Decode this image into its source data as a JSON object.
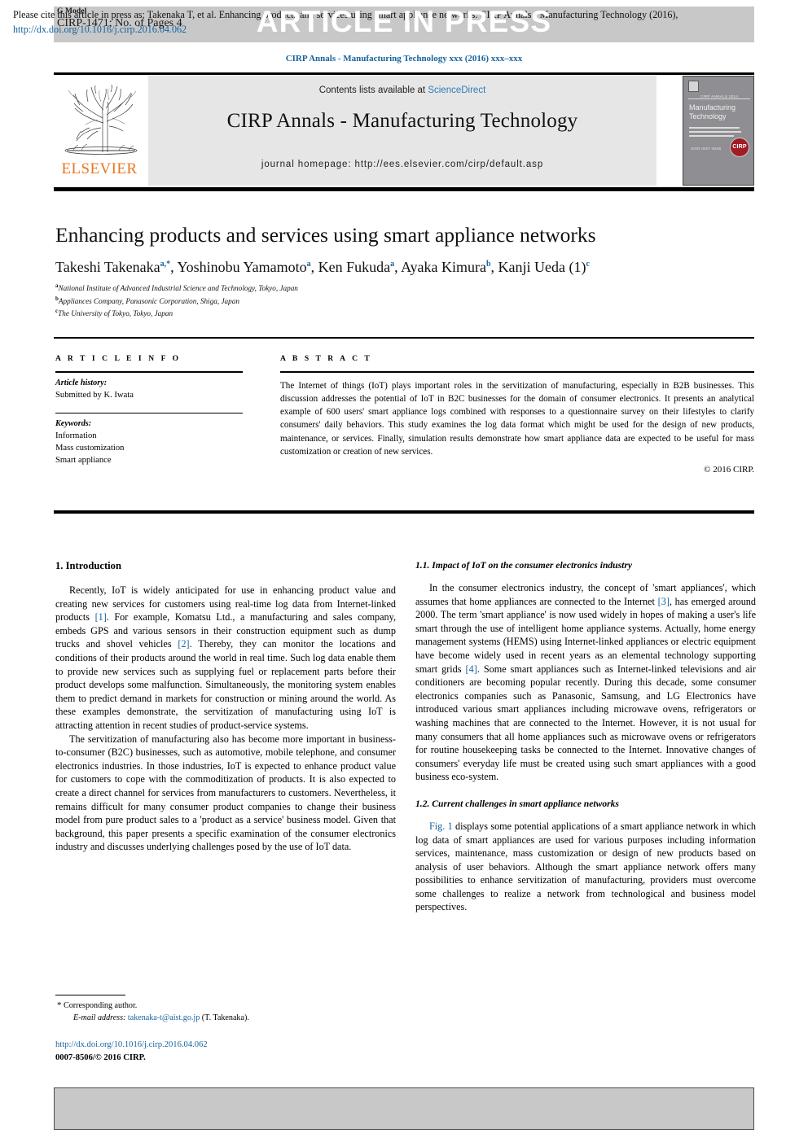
{
  "header": {
    "g_model_label": "G Model",
    "article_id": "CIRP-1471; No. of Pages 4",
    "article_in_press": "ARTICLE IN PRESS",
    "journal_ref": "CIRP Annals - Manufacturing Technology xxx (2016) xxx–xxx"
  },
  "masthead": {
    "contents_prefix": "Contents lists available at ",
    "contents_link": "ScienceDirect",
    "journal_name": "CIRP Annals - Manufacturing Technology",
    "homepage": "journal homepage: http://ees.elsevier.com/cirp/default.asp",
    "publisher_logo_text": "ELSEVIER",
    "cover": {
      "annals_line": "CIRP ANNALS 2014",
      "title_line1": "Manufacturing",
      "title_line2": "Technology",
      "issn_line": "ISSN 0007-8506",
      "seal_text": "CIRP"
    },
    "link_color": "#2e7cb8"
  },
  "article": {
    "title": "Enhancing products and services using smart appliance networks",
    "authors": [
      {
        "name": "Takeshi Takenaka",
        "marks": "a,*"
      },
      {
        "name": "Yoshinobu Yamamoto",
        "marks": "a"
      },
      {
        "name": "Ken Fukuda",
        "marks": "a"
      },
      {
        "name": "Ayaka Kimura",
        "marks": "b"
      },
      {
        "name": "Kanji Ueda (1)",
        "marks": "c"
      }
    ],
    "affiliations": [
      {
        "mark": "a",
        "text": "National Institute of Advanced Industrial Science and Technology, Tokyo, Japan"
      },
      {
        "mark": "b",
        "text": "Appliances Company, Panasonic Corporation, Shiga, Japan"
      },
      {
        "mark": "c",
        "text": "The University of Tokyo, Tokyo, Japan"
      }
    ]
  },
  "article_info": {
    "heading": "A R T I C L E   I N F O",
    "history_label": "Article history:",
    "history_value": "Submitted by K. Iwata",
    "keywords_label": "Keywords:",
    "keywords": [
      "Information",
      "Mass customization",
      "Smart appliance"
    ]
  },
  "abstract": {
    "heading": "A B S T R A C T",
    "text": "The Internet of things (IoT) plays important roles in the servitization of manufacturing, especially in B2B businesses. This discussion addresses the potential of IoT in B2C businesses for the domain of consumer electronics. It presents an analytical example of 600 users' smart appliance logs combined with responses to a questionnaire survey on their lifestyles to clarify consumers' daily behaviors. This study examines the log data format which might be used for the design of new products, maintenance, or services. Finally, simulation results demonstrate how smart appliance data are expected to be useful for mass customization or creation of new services.",
    "copyright": "© 2016 CIRP."
  },
  "body": {
    "section1_heading": "1. Introduction",
    "p1_a": "Recently, IoT is widely anticipated for use in enhancing product value and creating new services for customers using real-time log data from Internet-linked products ",
    "p1_ref1": "[1]",
    "p1_b": ". For example, Komatsu Ltd., a manufacturing and sales company, embeds GPS and various sensors in their construction equipment such as dump trucks and shovel vehicles ",
    "p1_ref2": "[2]",
    "p1_c": ". Thereby, they can monitor the locations and conditions of their products around the world in real time. Such log data enable them to provide new services such as supplying fuel or replacement parts before their product develops some malfunction. Simultaneously, the monitoring system enables them to predict demand in markets for construction or mining around the world. As these examples demonstrate, the servitization of manufacturing using IoT is attracting attention in recent studies of product-service systems.",
    "p2": "The servitization of manufacturing also has become more important in business-to-consumer (B2C) businesses, such as automotive, mobile telephone, and consumer electronics industries. In those industries, IoT is expected to enhance product value for customers to cope with the commoditization of products. It is also expected to create a direct channel for services from manufacturers to customers. Nevertheless, it remains difficult for many consumer product companies to change their business model from pure product sales to a 'product as a service' business model. Given that background, this paper presents a specific examination of the consumer electronics industry and discusses underlying challenges posed by the use of IoT data.",
    "subsection11_heading": "1.1. Impact of IoT on the consumer electronics industry",
    "p3_a": "In the consumer electronics industry, the concept of 'smart appliances', which assumes that home appliances are connected to the Internet ",
    "p3_ref3": "[3]",
    "p3_b": ", has emerged around 2000. The term 'smart appliance' is now used widely in hopes of making a user's life smart through the use of intelligent home appliance systems. Actually, home energy management systems (HEMS) using Internet-linked appliances or electric equipment have become widely used in recent years as an elemental technology supporting smart grids ",
    "p3_ref4": "[4]",
    "p3_c": ". Some smart appliances such as Internet-linked televisions and air conditioners are becoming popular recently. During this decade, some consumer electronics companies such as Panasonic, Samsung, and LG Electronics have introduced various smart appliances including microwave ovens, refrigerators or washing machines that are connected to the Internet. However, it is not usual for many consumers that all home appliances such as microwave ovens or refrigerators for routine housekeeping tasks be connected to the Internet. Innovative changes of consumers' everyday life must be created using such smart appliances with a good business eco-system.",
    "subsection12_heading": "1.2. Current challenges in smart appliance networks",
    "p4_fig": "Fig. 1",
    "p4_text": " displays some potential applications of a smart appliance network in which log data of smart appliances are used for various purposes including information services, maintenance, mass customization or design of new products based on analysis of user behaviors. Although the smart appliance network offers many possibilities to enhance servitization of manufacturing, providers must overcome some challenges to realize a network from technological and business model perspectives.",
    "ref_color": "#17639c"
  },
  "footnotes": {
    "corresponding": "Corresponding author.",
    "email_label": "E-mail address:",
    "email": "takenaka-t@aist.go.jp",
    "email_suffix": " (T. Takenaka).",
    "doi": "http://dx.doi.org/10.1016/j.cirp.2016.04.062",
    "issn_copyright": "0007-8506/© 2016 CIRP."
  },
  "cite_box": {
    "text_part1": "Please cite this article in press as: Takenaka T, et al. Enhancing products and services using smart appliance networks. CIRP Annals - Manufacturing Technology (2016), ",
    "doi_link": "http://dx.doi.org/10.1016/j.cirp.2016.04.062"
  }
}
